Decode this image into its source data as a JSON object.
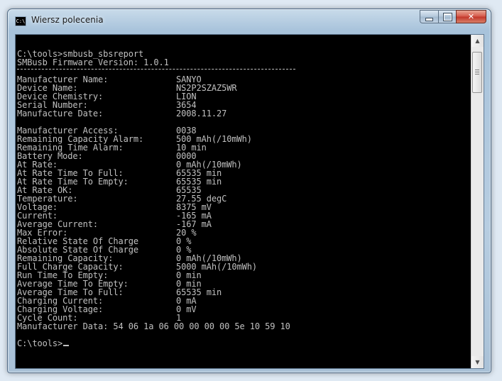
{
  "window": {
    "title": "Wiersz polecenia",
    "icon_name": "cmd-icon",
    "icon_text": "C:\\",
    "controls": {
      "minimize": "minimize-icon",
      "maximize": "maximize-icon",
      "close_symbol": "✕"
    }
  },
  "console": {
    "command_line": "C:\\tools>smbusb_sbsreport",
    "firmware_line": "SMBusb Firmware Version: 1.0.1",
    "separator": "-------------------------------------------------",
    "info": [
      {
        "label": "Manufacturer Name:",
        "value": "SANYO"
      },
      {
        "label": "Device Name:",
        "value": "NS2P2SZAZ5WR"
      },
      {
        "label": "Device Chemistry:",
        "value": "LION"
      },
      {
        "label": "Serial Number:",
        "value": "3654"
      },
      {
        "label": "Manufacture Date:",
        "value": "2008.11.27"
      }
    ],
    "params": [
      {
        "label": "Manufacturer Access:",
        "value": "0038"
      },
      {
        "label": "Remaining Capacity Alarm:",
        "value": "500 mAh(/10mWh)"
      },
      {
        "label": "Remaining Time Alarm:",
        "value": "10 min"
      },
      {
        "label": "Battery Mode:",
        "value": "0000"
      },
      {
        "label": "At Rate:",
        "value": "0 mAh(/10mWh)"
      },
      {
        "label": "At Rate Time To Full:",
        "value": "65535 min"
      },
      {
        "label": "At Rate Time To Empty:",
        "value": "65535 min"
      },
      {
        "label": "At Rate OK:",
        "value": "65535"
      },
      {
        "label": "Temperature:",
        "value": "27.55 degC"
      },
      {
        "label": "Voltage:",
        "value": "8375 mV"
      },
      {
        "label": "Current:",
        "value": "-165 mA"
      },
      {
        "label": "Average Current:",
        "value": "-167 mA"
      },
      {
        "label": "Max Error:",
        "value": "20 %"
      },
      {
        "label": "Relative State Of Charge",
        "value": "0 %"
      },
      {
        "label": "Absolute State Of Charge",
        "value": "0 %"
      },
      {
        "label": "Remaining Capacity:",
        "value": "0 mAh(/10mWh)"
      },
      {
        "label": "Full Charge Capacity:",
        "value": "5000 mAh(/10mWh)"
      },
      {
        "label": "Run Time To Empty:",
        "value": "0 min"
      },
      {
        "label": "Average Time To Empty:",
        "value": "0 min"
      },
      {
        "label": "Average Time To Full:",
        "value": "65535 min"
      },
      {
        "label": "Charging Current:",
        "value": "0 mA"
      },
      {
        "label": "Charging Voltage:",
        "value": "0 mV"
      },
      {
        "label": "Cycle Count:",
        "value": "1"
      }
    ],
    "manufacturer_data_line": "Manufacturer Data: 54 06 1a 06 00 00 00 00 5e 10 59 10",
    "prompt": "C:\\tools>"
  },
  "colors": {
    "console_bg": "#000000",
    "console_fg": "#c0c0c0",
    "close_button": "#c7372b"
  }
}
